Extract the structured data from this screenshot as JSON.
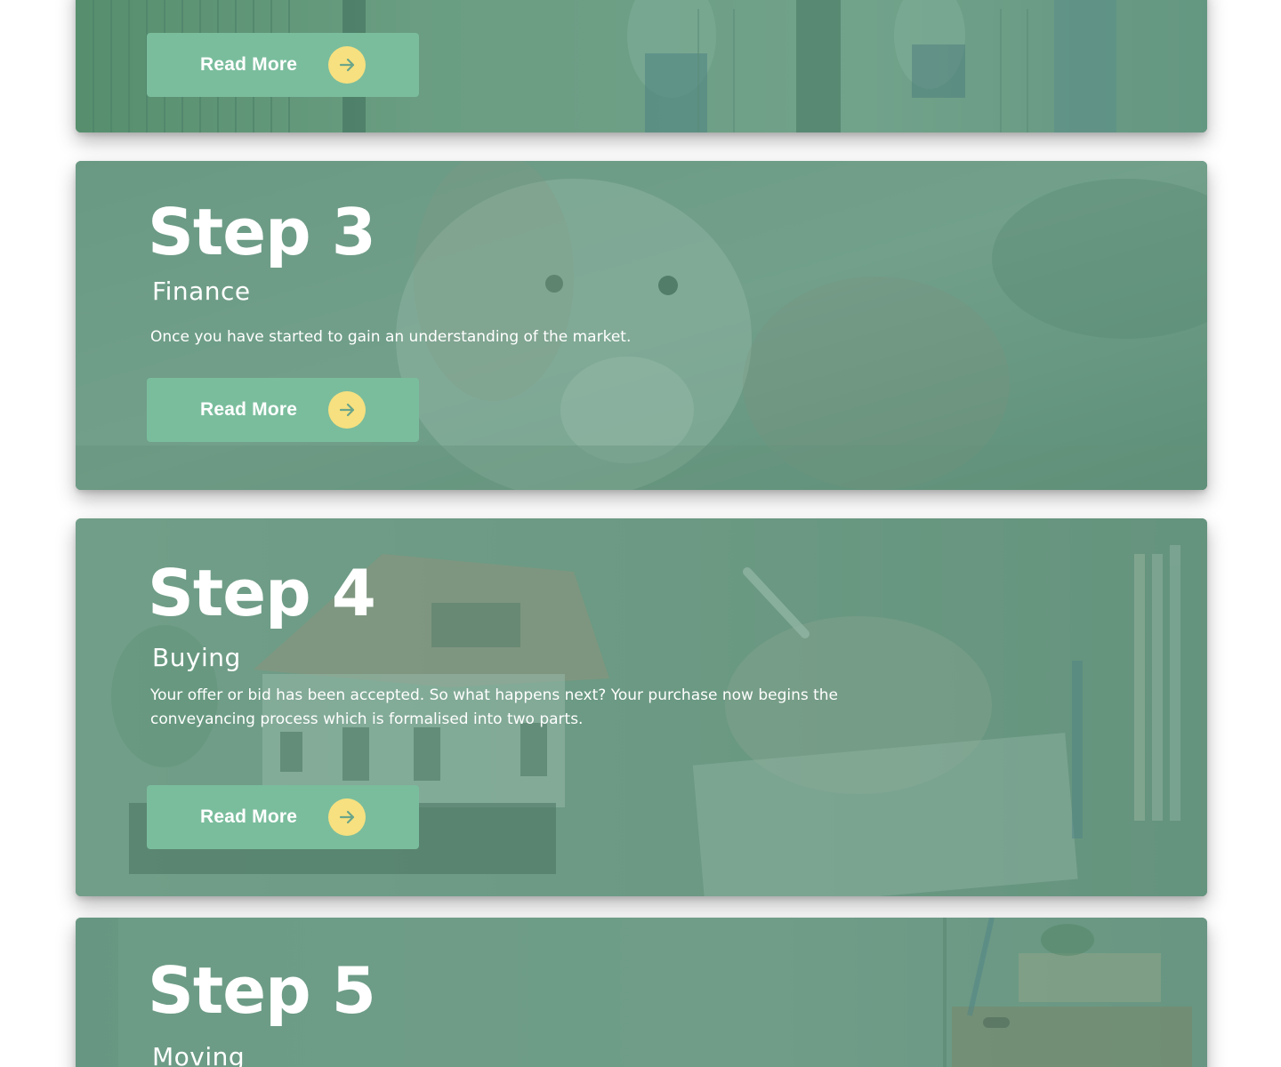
{
  "colors": {
    "card_tint": "#5c947c",
    "button_bg": "#7abd9d",
    "arrow_circle": "#f7e07f",
    "arrow_stroke": "#6aa58a",
    "text": "#ffffff"
  },
  "cards": [
    {
      "read_more_label": "Read More",
      "arrow_icon": "arrow-right-icon"
    },
    {
      "title": "Step 3",
      "subtitle": "Finance",
      "description": "Once you have started to gain an understanding of the market.",
      "read_more_label": "Read More",
      "arrow_icon": "arrow-right-icon"
    },
    {
      "title": "Step 4",
      "subtitle": "Buying",
      "description": "Your offer or bid has been accepted. So what happens next? Your purchase now begins the conveyancing process which is formalised into two parts.",
      "read_more_label": "Read More",
      "arrow_icon": "arrow-right-icon"
    },
    {
      "title": "Step 5",
      "subtitle": "Moving"
    }
  ]
}
